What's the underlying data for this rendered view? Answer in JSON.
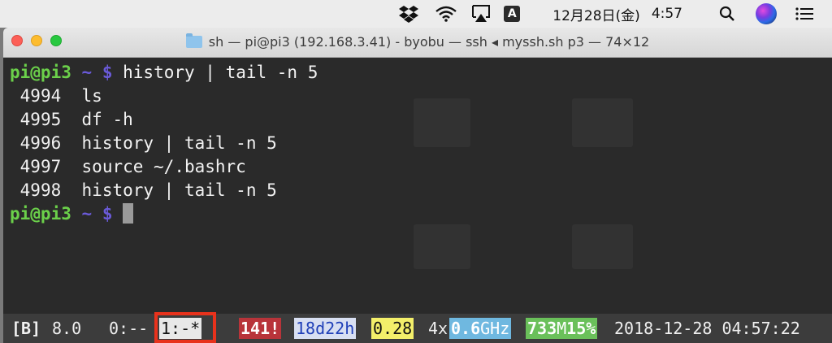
{
  "menubar": {
    "input_source": "A",
    "date": "12月28日(金)",
    "time": "4:57"
  },
  "window": {
    "title": "sh — pi@pi3 (192.168.3.41) - byobu — ssh ◂ myssh.sh p3 — 74×12"
  },
  "terminal": {
    "prompt_user": "pi@pi3",
    "prompt_path": "~",
    "prompt_symbol": "$",
    "command": "history | tail -n 5",
    "history": [
      {
        "num": "4994",
        "cmd": "ls"
      },
      {
        "num": "4995",
        "cmd": "df -h"
      },
      {
        "num": "4996",
        "cmd": "history | tail -n 5"
      },
      {
        "num": "4997",
        "cmd": "source ~/.bashrc"
      },
      {
        "num": "4998",
        "cmd": "history | tail -n 5"
      }
    ]
  },
  "statusbar": {
    "badge": "[B]",
    "version": "8.0",
    "window0": "0:--",
    "window1": "1:-*",
    "packages": "141!",
    "uptime": "18d22h",
    "load": "0.28",
    "cpu_count": "4x",
    "cpu_freq_value": "0.6",
    "cpu_freq_unit": "GHz",
    "mem_total": "733",
    "mem_unit": "M",
    "mem_pct": "15%",
    "datetime": "2018-12-28 04:57:22"
  }
}
